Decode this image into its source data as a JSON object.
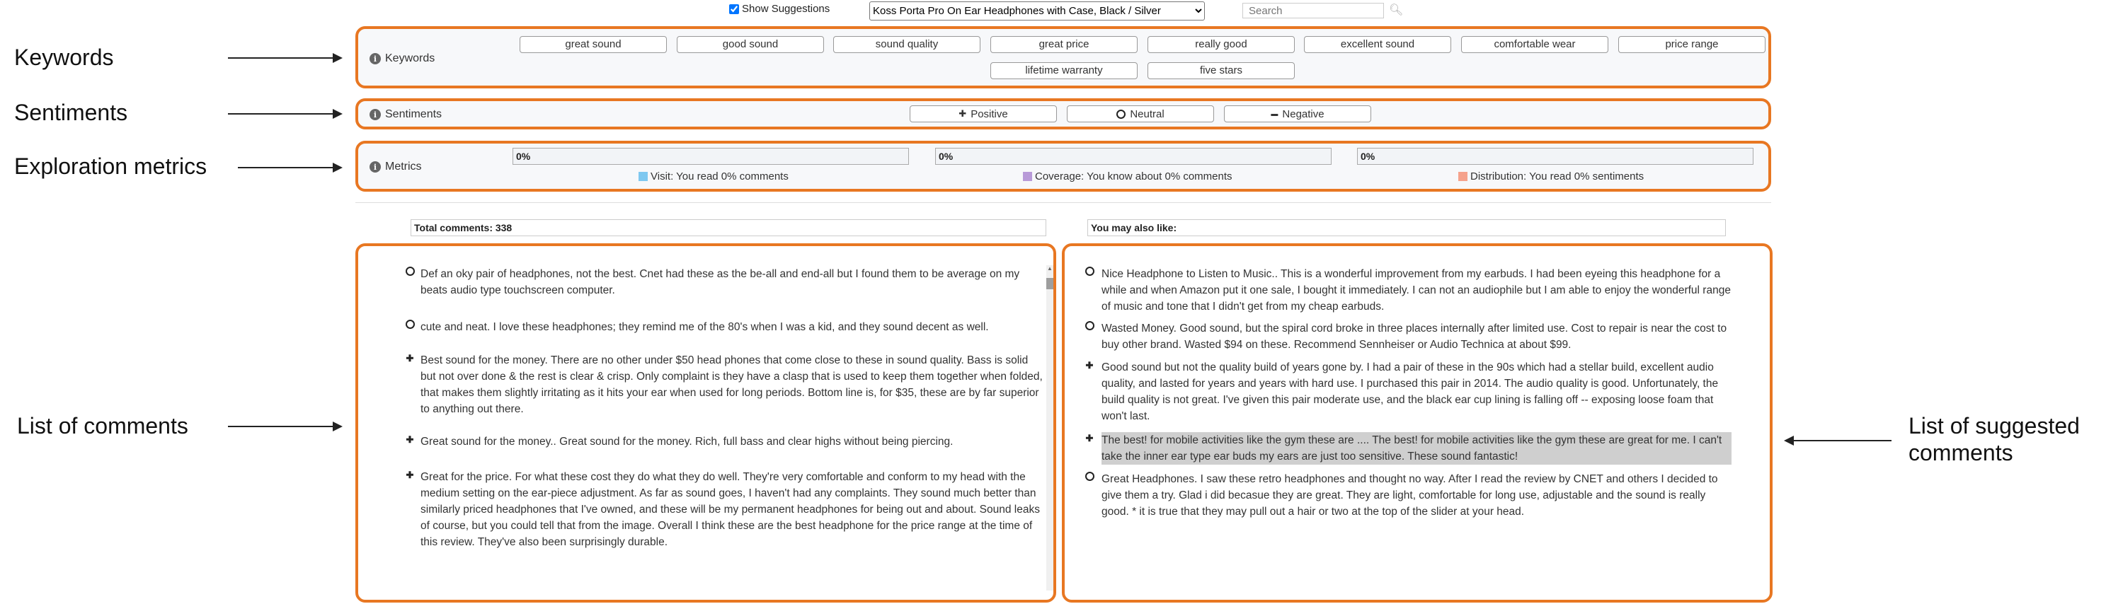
{
  "top": {
    "show_suggestions_label": "Show Suggestions",
    "show_suggestions_checked": true,
    "product_selected": "Koss Porta Pro On Ear Headphones with Case, Black / Silver",
    "search_placeholder": "Search"
  },
  "annotations": {
    "keywords": "Keywords",
    "sentiments": "Sentiments",
    "exploration": "Exploration metrics",
    "list_comments": "List of comments",
    "list_suggested": "List of suggested\ncomments"
  },
  "keywords_panel": {
    "label": "Keywords",
    "items": [
      "great sound",
      "good sound",
      "sound quality",
      "great price",
      "really good",
      "excellent sound",
      "comfortable wear",
      "price range",
      "lifetime warranty",
      "five stars"
    ]
  },
  "sentiments_panel": {
    "label": "Sentiments",
    "items": [
      {
        "label": "Positive",
        "icon": "plus-icon"
      },
      {
        "label": "Neutral",
        "icon": "circle-icon"
      },
      {
        "label": "Negative",
        "icon": "minus-icon"
      }
    ]
  },
  "metrics_panel": {
    "label": "Metrics",
    "metrics": [
      {
        "value": "0%",
        "fraction": 0,
        "caption": "Visit: You read 0% comments",
        "color": "#7ec8f0"
      },
      {
        "value": "0%",
        "fraction": 0,
        "caption": "Coverage: You know about 0% comments",
        "color": "#b89ad8"
      },
      {
        "value": "0%",
        "fraction": 0,
        "caption": "Distribution: You read 0% sentiments",
        "color": "#f5a28c"
      }
    ]
  },
  "comments": {
    "header": "Total comments: 338",
    "items": [
      {
        "sentiment": "neutral",
        "text": "Def an oky pair of headphones, not the best. Cnet had these as the be-all and end-all but I found them to be average on my beats audio type touchscreen computer."
      },
      {
        "sentiment": "neutral",
        "text": "cute and neat. I love these headphones; they remind me of the 80's when I was a kid, and they sound decent as well."
      },
      {
        "sentiment": "positive",
        "text": "Best sound for the money. There are no other under $50 head phones that come close to these in sound quality. Bass is solid but not over done & the rest is clear & crisp. Only complaint is they have a clasp that is used to keep them together when folded, that makes them slightly irritating as it hits your ear when used for long periods. Bottom line is, for $35, these are by far superior to anything out there."
      },
      {
        "sentiment": "positive",
        "text": "Great sound for the money.. Great sound for the money. Rich, full bass and clear highs without being piercing."
      },
      {
        "sentiment": "positive",
        "text": "Great for the price. For what these cost they do what they do well. They're very comfortable and conform to my head with the medium setting on the ear-piece adjustment. As far as sound goes, I haven't had any complaints. They sound much better than similarly priced headphones that I've owned, and these will be my permanent headphones for being out and about. Sound leaks of course, but you could tell that from the image. Overall I think these are the best headphone for the price range at the time of this review. They've also been surprisingly durable."
      }
    ]
  },
  "suggestions": {
    "header": "You may also like:",
    "items": [
      {
        "sentiment": "neutral",
        "text": "Nice Headphone to Listen to Music.. This is a wonderful improvement from my earbuds. I had been eyeing this headphone for a while and when Amazon put it one sale, I bought it immediately. I can not an audiophile but I am able to enjoy the wonderful range of music and tone that I didn't get from my cheap earbuds.",
        "highlighted": false
      },
      {
        "sentiment": "neutral",
        "text": "Wasted Money. Good sound, but the spiral cord broke in three places internally after limited use. Cost to repair is near the cost to buy other brand. Wasted $94 on these. Recommend Sennheiser or Audio Technica at about $99.",
        "highlighted": false
      },
      {
        "sentiment": "positive",
        "text": "Good sound but not the quality build of years gone by. I had a pair of these in the 90s which had a stellar build, excellent audio quality, and lasted for years and years with hard use. I purchased this pair in 2014. The audio quality is good. Unfortunately, the build quality is not great. I've given this pair moderate use, and the black ear cup lining is falling off -- exposing loose foam that won't last.",
        "highlighted": false
      },
      {
        "sentiment": "positive",
        "text": "The best! for mobile activities like the gym these are .... The best! for mobile activities like the gym these are great for me. I can't take the inner ear type ear buds my ears are just too sensitive. These sound fantastic!",
        "highlighted": true
      },
      {
        "sentiment": "neutral",
        "text": "Great Headphones. I saw these retro headphones and thought no way. After I read the review by CNET and others I decided to give them a try. Glad i did becasue they are great. They are light, comfortable for long use, adjustable and the sound is really good. * it is true that they may pull out a hair or two at the top of the slider at your head.",
        "highlighted": false
      }
    ]
  }
}
